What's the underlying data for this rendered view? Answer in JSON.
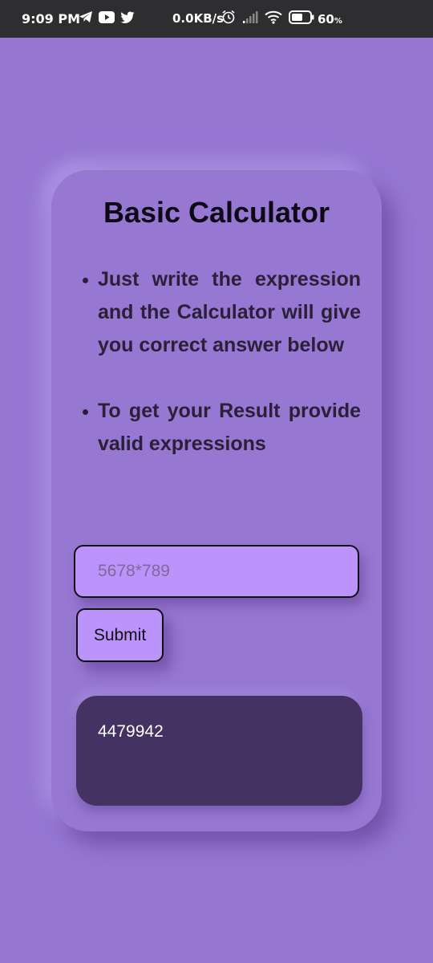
{
  "status_bar": {
    "time": "9:09 PM",
    "left_icons": [
      "telegram-icon",
      "youtube-icon",
      "twitter-icon"
    ],
    "network_speed": "0.0KB/s",
    "right_icons": [
      "alarm-icon",
      "signal-icon",
      "wifi-icon",
      "battery-icon"
    ],
    "battery_percent": "60",
    "battery_unit": "%"
  },
  "calculator": {
    "title": "Basic Calculator",
    "instructions": [
      "Just write the expression and the Calculator will give you correct answer below",
      "To get your Result provide valid expressions"
    ],
    "input": {
      "value": "",
      "placeholder": "5678*789"
    },
    "submit_label": "Submit",
    "result": "4479942"
  },
  "colors": {
    "background": "#9576d3",
    "status_bar": "#2e2e30",
    "input_fill": "#bb93fb",
    "result_fill": "#433262"
  }
}
